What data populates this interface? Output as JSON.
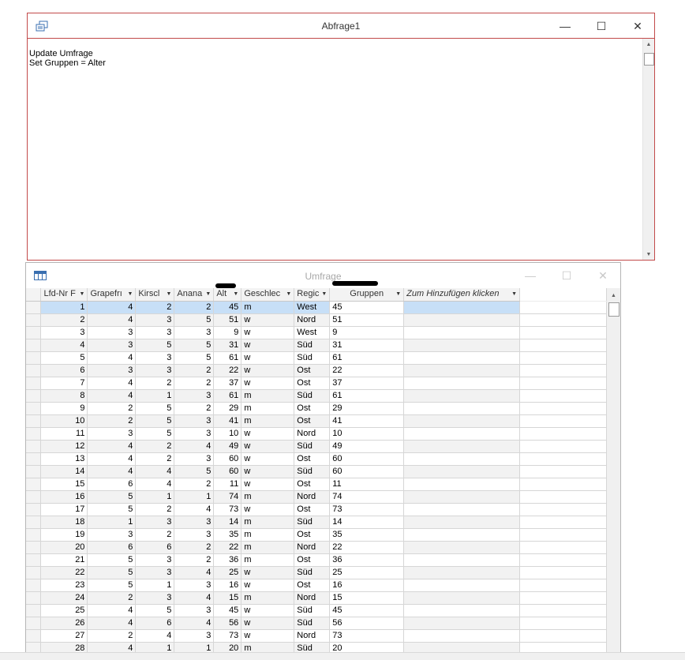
{
  "query_window": {
    "title": "Abfrage1",
    "sql_text": "Update Umfrage\nSet Gruppen = Alter",
    "minimize_glyph": "—",
    "maximize_glyph": "☐",
    "close_glyph": "✕",
    "icon": "query-icon"
  },
  "table_window": {
    "title": "Umfrage",
    "minimize_glyph": "—",
    "maximize_glyph": "☐",
    "close_glyph": "✕",
    "icon": "table-icon"
  },
  "datasheet": {
    "columns": [
      "Lfd-Nr F",
      "Grapefrı",
      "Kirscl",
      "Anana",
      "Alt",
      "Geschlec",
      "Regic",
      "Gruppen",
      "Zum Hinzufügen klicken"
    ],
    "rows": [
      [
        "1",
        "4",
        "2",
        "2",
        "45",
        "m",
        "West",
        "45"
      ],
      [
        "2",
        "4",
        "3",
        "5",
        "51",
        "w",
        "Nord",
        "51"
      ],
      [
        "3",
        "3",
        "3",
        "3",
        "9",
        "w",
        "West",
        "9"
      ],
      [
        "4",
        "3",
        "5",
        "5",
        "31",
        "w",
        "Süd",
        "31"
      ],
      [
        "5",
        "4",
        "3",
        "5",
        "61",
        "w",
        "Süd",
        "61"
      ],
      [
        "6",
        "3",
        "3",
        "2",
        "22",
        "w",
        "Ost",
        "22"
      ],
      [
        "7",
        "4",
        "2",
        "2",
        "37",
        "w",
        "Ost",
        "37"
      ],
      [
        "8",
        "4",
        "1",
        "3",
        "61",
        "m",
        "Süd",
        "61"
      ],
      [
        "9",
        "2",
        "5",
        "2",
        "29",
        "m",
        "Ost",
        "29"
      ],
      [
        "10",
        "2",
        "5",
        "3",
        "41",
        "m",
        "Ost",
        "41"
      ],
      [
        "11",
        "3",
        "5",
        "3",
        "10",
        "w",
        "Nord",
        "10"
      ],
      [
        "12",
        "4",
        "2",
        "4",
        "49",
        "w",
        "Süd",
        "49"
      ],
      [
        "13",
        "4",
        "2",
        "3",
        "60",
        "w",
        "Ost",
        "60"
      ],
      [
        "14",
        "4",
        "4",
        "5",
        "60",
        "w",
        "Süd",
        "60"
      ],
      [
        "15",
        "6",
        "4",
        "2",
        "11",
        "w",
        "Ost",
        "11"
      ],
      [
        "16",
        "5",
        "1",
        "1",
        "74",
        "m",
        "Nord",
        "74"
      ],
      [
        "17",
        "5",
        "2",
        "4",
        "73",
        "w",
        "Ost",
        "73"
      ],
      [
        "18",
        "1",
        "3",
        "3",
        "14",
        "m",
        "Süd",
        "14"
      ],
      [
        "19",
        "3",
        "2",
        "3",
        "35",
        "m",
        "Ost",
        "35"
      ],
      [
        "20",
        "6",
        "6",
        "2",
        "22",
        "m",
        "Nord",
        "22"
      ],
      [
        "21",
        "5",
        "3",
        "2",
        "36",
        "m",
        "Ost",
        "36"
      ],
      [
        "22",
        "5",
        "3",
        "4",
        "25",
        "w",
        "Süd",
        "25"
      ],
      [
        "23",
        "5",
        "1",
        "3",
        "16",
        "w",
        "Ost",
        "16"
      ],
      [
        "24",
        "2",
        "3",
        "4",
        "15",
        "m",
        "Nord",
        "15"
      ],
      [
        "25",
        "4",
        "5",
        "3",
        "45",
        "w",
        "Süd",
        "45"
      ],
      [
        "26",
        "4",
        "6",
        "4",
        "56",
        "w",
        "Süd",
        "56"
      ],
      [
        "27",
        "2",
        "4",
        "3",
        "73",
        "w",
        "Nord",
        "73"
      ],
      [
        "28",
        "4",
        "1",
        "1",
        "20",
        "m",
        "Süd",
        "20"
      ]
    ],
    "current_row_index": 0,
    "colors": {
      "selected_row": "#c7dff7",
      "query_window_border": "#c24a4a"
    }
  }
}
